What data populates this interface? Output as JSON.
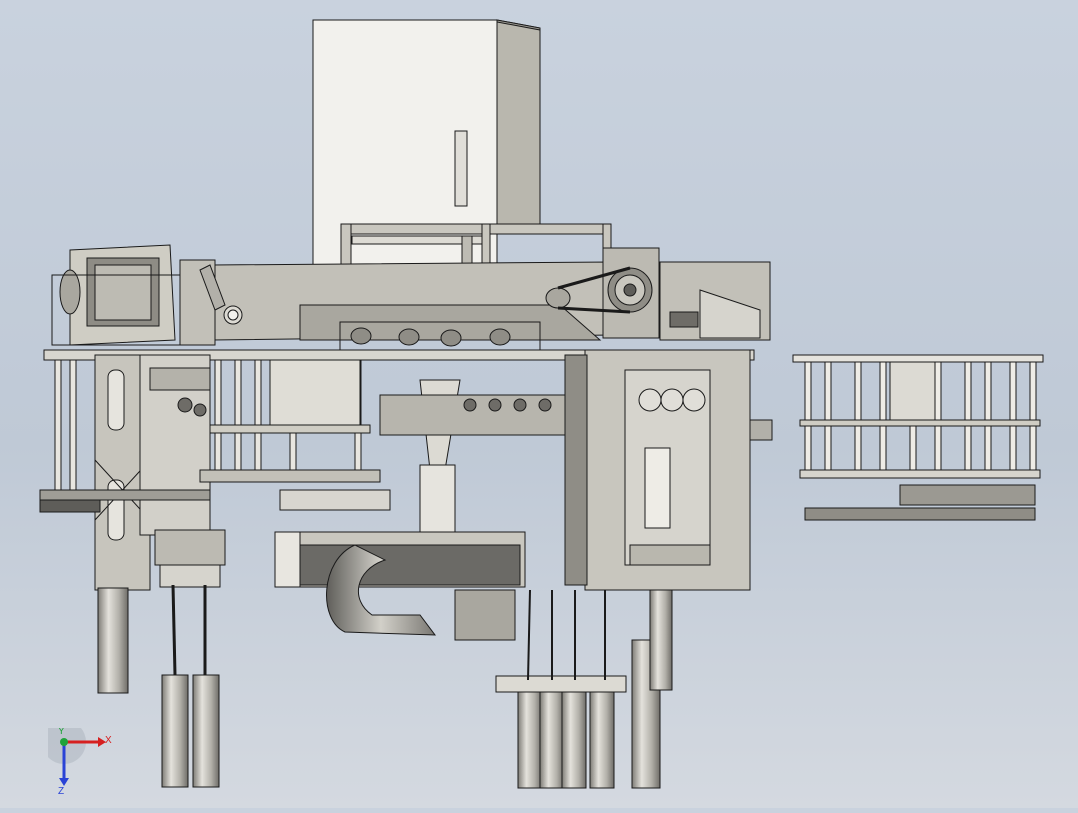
{
  "viewport": {
    "background_top": "#c9d2de",
    "background_bottom": "#d4d9e0",
    "line_color": "#1a1a1a",
    "body_color": "#cfcdc4",
    "panel_light": "#e8e6e0",
    "panel_mid": "#b9b7ae",
    "panel_dark": "#8f8d86",
    "metal_dark": "#5e5d59"
  },
  "triad": {
    "x_label": "X",
    "y_label": "Y",
    "z_label": "Z",
    "x_color": "#d62020",
    "y_color": "#1fa33a",
    "z_color": "#2a43d6"
  }
}
